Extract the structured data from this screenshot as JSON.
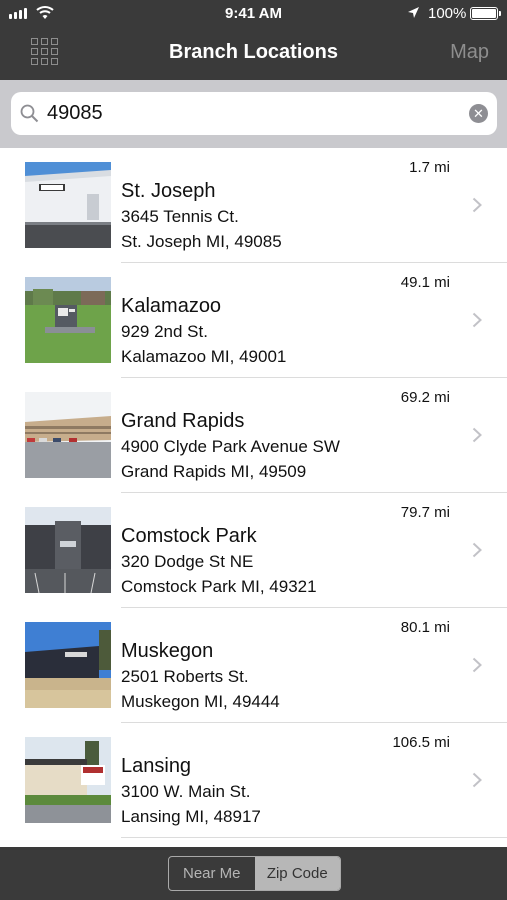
{
  "status_bar": {
    "time": "9:41 AM",
    "battery_percent": "100%",
    "battery_level": 1.0,
    "icons": [
      "signal-icon",
      "wifi-icon",
      "location-arrow-icon",
      "battery-icon"
    ]
  },
  "nav": {
    "title": "Branch Locations",
    "map_label": "Map",
    "menu_icon": "grid-menu-icon"
  },
  "search": {
    "value": "49085",
    "icon": "search-icon",
    "clear_icon": "clear-icon"
  },
  "branches": [
    {
      "name": "St. Joseph",
      "street": "3645 Tennis Ct.",
      "city_line": "St. Joseph MI, 49085",
      "distance": "1.7 mi"
    },
    {
      "name": "Kalamazoo",
      "street": "929 2nd St.",
      "city_line": "Kalamazoo MI, 49001",
      "distance": "49.1 mi"
    },
    {
      "name": "Grand Rapids",
      "street": "4900 Clyde Park Avenue SW",
      "city_line": "Grand Rapids MI, 49509",
      "distance": "69.2 mi"
    },
    {
      "name": "Comstock Park",
      "street": "320 Dodge St NE",
      "city_line": "Comstock Park MI, 49321",
      "distance": "79.7 mi"
    },
    {
      "name": "Muskegon",
      "street": "2501 Roberts St.",
      "city_line": "Muskegon MI, 49444",
      "distance": "80.1 mi"
    },
    {
      "name": "Lansing",
      "street": "3100 W. Main St.",
      "city_line": "Lansing MI, 48917",
      "distance": "106.5 mi"
    }
  ],
  "bottom": {
    "near_me_label": "Near Me",
    "zip_code_label": "Zip Code",
    "selected": "Zip Code"
  },
  "colors": {
    "bar_background": "#3a3a3a",
    "search_background": "#c9c9cd",
    "selected_segment": "#b7b7b7"
  }
}
